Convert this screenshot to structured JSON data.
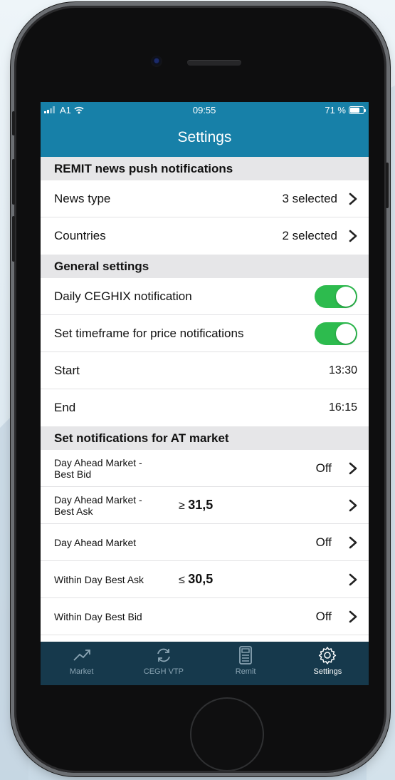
{
  "status": {
    "carrier": "A1",
    "time": "09:55",
    "battery": "71 %",
    "battery_level": 0.71
  },
  "header": {
    "title": "Settings"
  },
  "sections": {
    "remit": {
      "title": "REMIT news push notifications",
      "news_type_label": "News type",
      "news_type_value": "3 selected",
      "countries_label": "Countries",
      "countries_value": "2 selected"
    },
    "general": {
      "title": "General settings",
      "daily_label": "Daily CEGHIX notification",
      "timeframe_label": "Set timeframe for price notifications",
      "start_label": "Start",
      "start_value": "13:30",
      "end_label": "End",
      "end_value": "16:15"
    },
    "market": {
      "title": "Set notifications for AT market",
      "items": [
        {
          "label_line1": "Day Ahead Market -",
          "label_line2": "Best Bid",
          "condition_op": "",
          "condition_value": "",
          "status": "Off"
        },
        {
          "label_line1": "Day Ahead Market -",
          "label_line2": "Best Ask",
          "condition_op": "≥",
          "condition_value": "31,5",
          "status": ""
        },
        {
          "label_line1": "Day Ahead Market",
          "label_line2": "",
          "condition_op": "",
          "condition_value": "",
          "status": "Off"
        },
        {
          "label_line1": "Within Day Best Ask",
          "label_line2": "",
          "condition_op": "≤",
          "condition_value": "30,5",
          "status": ""
        },
        {
          "label_line1": "Within Day Best Bid",
          "label_line2": "",
          "condition_op": "",
          "condition_value": "",
          "status": "Off"
        }
      ]
    }
  },
  "tabbar": {
    "tabs": [
      {
        "label": "Market",
        "icon": "trend-icon"
      },
      {
        "label": "CEGH VTP",
        "icon": "sync-icon"
      },
      {
        "label": "Remit",
        "icon": "calculator-icon"
      },
      {
        "label": "Settings",
        "icon": "gear-icon"
      }
    ]
  },
  "colors": {
    "header_bg": "#1780a8",
    "toggle_on": "#2dbb4e",
    "tabbar_bg": "#16394c",
    "section_bg": "#e6e6e8"
  }
}
